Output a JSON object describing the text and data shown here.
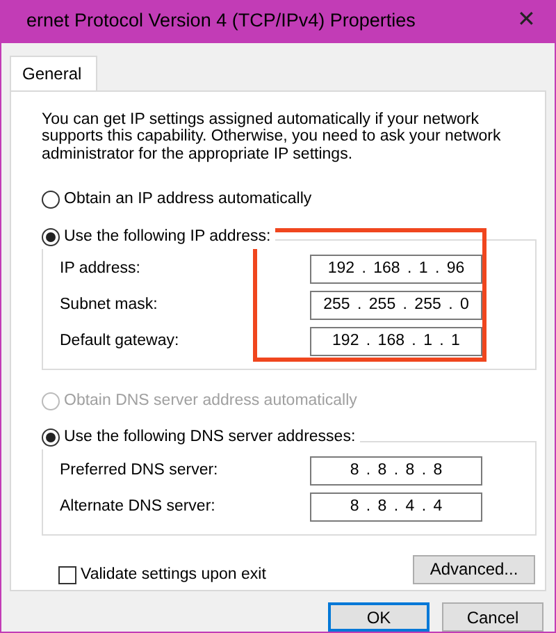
{
  "window": {
    "title": "ernet Protocol Version 4 (TCP/IPv4) Properties",
    "close": "✕"
  },
  "tabs": [
    {
      "label": "General",
      "selected": true
    }
  ],
  "description": "You can get IP settings assigned automatically if your network supports this capability. Otherwise, you need to ask your network administrator for the appropriate IP settings.",
  "ip_section": {
    "auto_option": {
      "label": "Obtain an IP address automatically",
      "selected": false,
      "disabled": false
    },
    "manual_option": {
      "label": "Use the following IP address:",
      "selected": true,
      "disabled": false
    },
    "highlighted": true,
    "fields": [
      {
        "label": "IP address:",
        "value": "192 . 168 . 1 . 96"
      },
      {
        "label": "Subnet mask:",
        "value": "255 . 255 . 255 . 0"
      },
      {
        "label": "Default gateway:",
        "value": "192 . 168 . 1 . 1"
      }
    ]
  },
  "dns_section": {
    "auto_option": {
      "label": "Obtain DNS server address automatically",
      "selected": false,
      "disabled": true
    },
    "manual_option": {
      "label": "Use the following DNS server addresses:",
      "selected": true,
      "disabled": false
    },
    "fields": [
      {
        "label": "Preferred DNS server:",
        "value": "8 . 8 . 8 . 8"
      },
      {
        "label": "Alternate DNS server:",
        "value": "8 . 8 . 4 . 4"
      }
    ]
  },
  "validate": {
    "label": "Validate settings upon exit",
    "checked": false
  },
  "buttons": [
    {
      "label": "Advanced...",
      "kind": "panel",
      "default": false
    },
    {
      "label": "OK",
      "kind": "footer",
      "default": true
    },
    {
      "label": "Cancel",
      "kind": "footer",
      "default": false
    }
  ]
}
